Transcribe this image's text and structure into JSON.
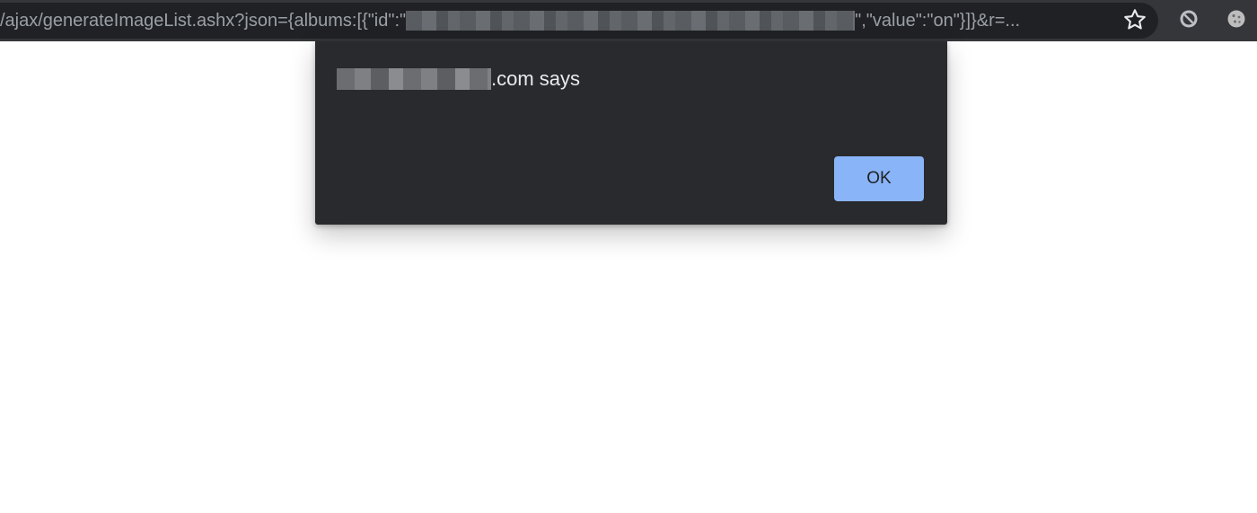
{
  "browser": {
    "address_bar": {
      "url_prefix": "/ajax/generateImageList.ashx?json={albums:[{\"id\":\"",
      "url_suffix": "\",\"value\":\"on\"}]}&r=..."
    },
    "toolbar_icons": [
      "star-icon",
      "blocked-extension-icon",
      "cookie-extension-icon"
    ]
  },
  "dialog": {
    "title_suffix": ".com says",
    "ok_label": "OK",
    "colors": {
      "background": "#292a2d",
      "button": "#8ab4f8",
      "text": "#e8eaed"
    }
  }
}
